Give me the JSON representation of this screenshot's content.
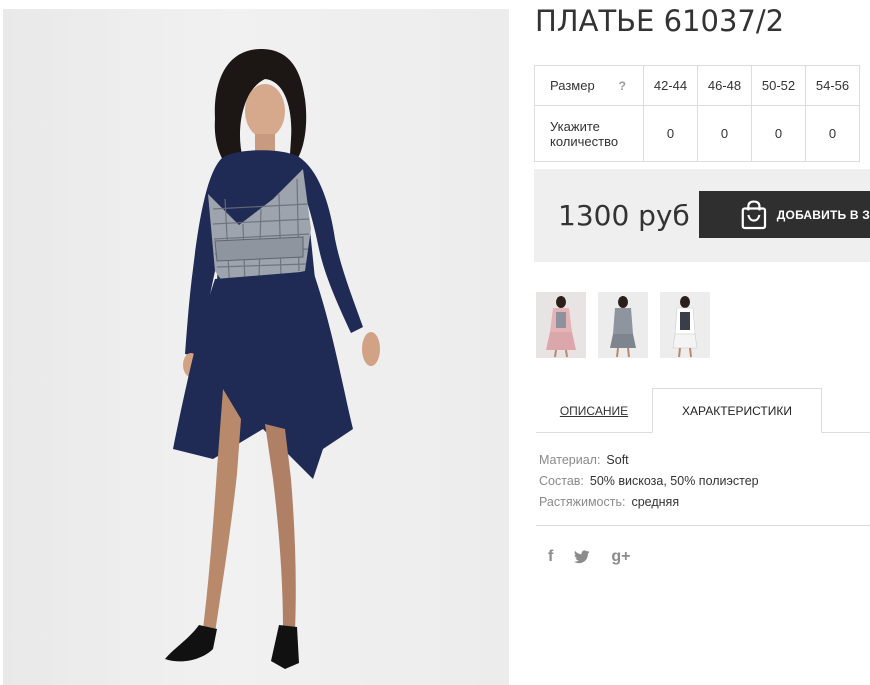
{
  "product": {
    "title": "ПЛАТЬЕ 61037/2",
    "photo_icon": "model-photo"
  },
  "size_table": {
    "size_label": "Размер",
    "help": "?",
    "sizes": [
      "42-44",
      "46-48",
      "50-52",
      "54-56"
    ],
    "qty_label_line1": "Укажите",
    "qty_label_line2": "количество",
    "quantities": [
      "0",
      "0",
      "0",
      "0"
    ]
  },
  "price": {
    "value": "1300 руб",
    "cart_button": "ДОБАВИТЬ В З",
    "cart_icon": "shopping-bag-icon"
  },
  "tabs": {
    "description": "ОПИСАНИЕ",
    "characteristics": "ХАРАКТЕРИСТИКИ",
    "active": "characteristics"
  },
  "specs": [
    {
      "label": "Материал:",
      "value": "Soft"
    },
    {
      "label": "Состав:",
      "value": "50% вискоза, 50% полиэстер"
    },
    {
      "label": "Растяжимость:",
      "value": "средняя"
    }
  ],
  "social": {
    "facebook": "f",
    "twitter_icon": "twitter-icon",
    "googleplus": "g+"
  },
  "colors": {
    "dress_navy": "#1f2a55",
    "button_dark": "#2f2f2f",
    "price_bg": "#efefef"
  }
}
